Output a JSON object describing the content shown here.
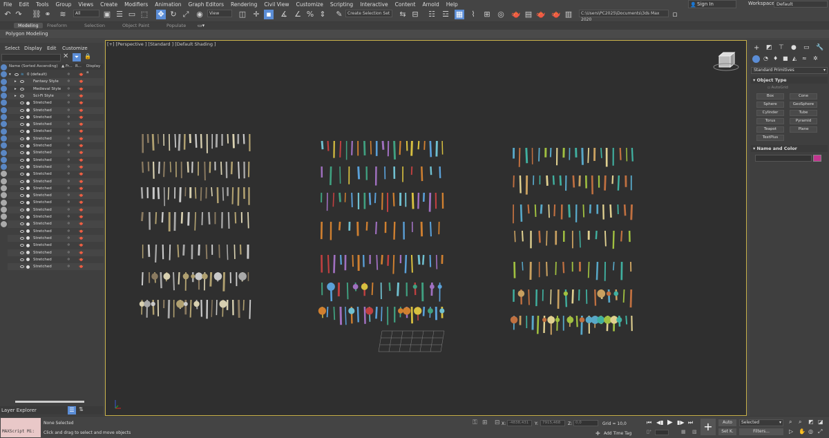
{
  "menu": [
    "File",
    "Edit",
    "Tools",
    "Group",
    "Views",
    "Create",
    "Modifiers",
    "Animation",
    "Graph Editors",
    "Rendering",
    "Civil View",
    "Customize",
    "Scripting",
    "Interactive",
    "Content",
    "Arnold",
    "Help"
  ],
  "signin": "Sign In",
  "workspaces_label": "Workspaces:",
  "workspaces_value": "Default",
  "toolbar": {
    "filter_combo": "All",
    "view_combo": "View",
    "selection_set": "Create Selection Set",
    "path": "C:\\Users\\PC2025\\Documents\\3ds Max 2020"
  },
  "ribbon_tabs": [
    "Modeling",
    "Freeform",
    "Selection",
    "Object Paint",
    "Populate"
  ],
  "ribbon_sub": "Polygon Modeling",
  "scene_explorer": {
    "menu": [
      "Select",
      "Display",
      "Edit",
      "Customize"
    ],
    "col_name": "Name (Sorted Ascending)",
    "col_fr": "▲ Fr...",
    "col_r": "R...",
    "col_display": "Display a",
    "rows": [
      {
        "name": "0 (default)",
        "kind": "layer"
      },
      {
        "name": "Fantasy Style",
        "kind": "group"
      },
      {
        "name": "Medieval Style",
        "kind": "group"
      },
      {
        "name": "Sci-Fi Style",
        "kind": "group"
      },
      {
        "name": "Stretched",
        "kind": "obj"
      },
      {
        "name": "Stretched",
        "kind": "obj"
      },
      {
        "name": "Stretched",
        "kind": "obj"
      },
      {
        "name": "Stretched",
        "kind": "obj"
      },
      {
        "name": "Stretched",
        "kind": "obj"
      },
      {
        "name": "Stretched",
        "kind": "obj"
      },
      {
        "name": "Stretched",
        "kind": "obj"
      },
      {
        "name": "Stretched",
        "kind": "obj"
      },
      {
        "name": "Stretched",
        "kind": "obj"
      },
      {
        "name": "Stretched",
        "kind": "obj"
      },
      {
        "name": "Stretched",
        "kind": "obj"
      },
      {
        "name": "Stretched",
        "kind": "obj"
      },
      {
        "name": "Stretched",
        "kind": "obj"
      },
      {
        "name": "Stretched",
        "kind": "obj"
      },
      {
        "name": "Stretched",
        "kind": "obj"
      },
      {
        "name": "Stretched",
        "kind": "obj"
      },
      {
        "name": "Stretched",
        "kind": "obj"
      },
      {
        "name": "Stretched",
        "kind": "obj"
      },
      {
        "name": "Stretched",
        "kind": "obj"
      },
      {
        "name": "Stretched",
        "kind": "obj"
      },
      {
        "name": "Stretched",
        "kind": "obj"
      },
      {
        "name": "Stretched",
        "kind": "obj"
      },
      {
        "name": "Stretched",
        "kind": "obj"
      },
      {
        "name": "Stretched",
        "kind": "obj"
      }
    ],
    "footer": "Layer Explorer"
  },
  "viewport_label": "[+] [Perspective ] [Standard ] [Default Shading ]",
  "command_panel": {
    "category": "Standard Primitives",
    "object_type_header": "Object Type",
    "autogrid": "AutoGrid",
    "buttons": [
      "Box",
      "Cone",
      "Sphere",
      "GeoSphere",
      "Cylinder",
      "Tube",
      "Torus",
      "Pyramid",
      "Teapot",
      "Plane",
      "TextPlus"
    ],
    "name_color_header": "Name and Color",
    "object_color": "#c2358f"
  },
  "status": {
    "maxscript": "MAXScript Mi:",
    "selection": "None Selected",
    "prompt": "Click and drag to select and move objects",
    "x_label": "X:",
    "x_value": "-4838,431",
    "y_label": "Y:",
    "y_value": "7915,468",
    "z_label": "Z:",
    "z_value": "0,0",
    "grid": "Grid = 10,0",
    "add_time_tag": "Add Time Tag",
    "auto": "Auto",
    "selected": "Selected",
    "set_k": "Set K.",
    "filters": "Filters..."
  }
}
